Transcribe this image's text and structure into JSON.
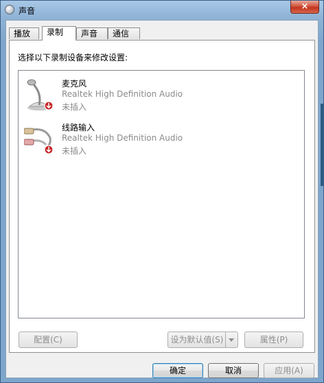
{
  "window": {
    "title": "声音",
    "close_glyph": "×"
  },
  "tabs": [
    {
      "label": "播放",
      "active": false
    },
    {
      "label": "录制",
      "active": true
    },
    {
      "label": "声音",
      "active": false
    },
    {
      "label": "通信",
      "active": false
    }
  ],
  "recording": {
    "instruction": "选择以下录制设备来修改设置:",
    "devices": [
      {
        "name": "麦克风",
        "driver": "Realtek High Definition Audio",
        "status": "未插入",
        "icon": "microphone-icon"
      },
      {
        "name": "线路输入",
        "driver": "Realtek High Definition Audio",
        "status": "未插入",
        "icon": "line-in-cable-icon"
      }
    ]
  },
  "buttons": {
    "configure": "配置(C)",
    "set_default": "设为默认值(S)",
    "properties": "属性(P)",
    "ok": "确定",
    "cancel": "取消",
    "apply": "应用(A)"
  }
}
